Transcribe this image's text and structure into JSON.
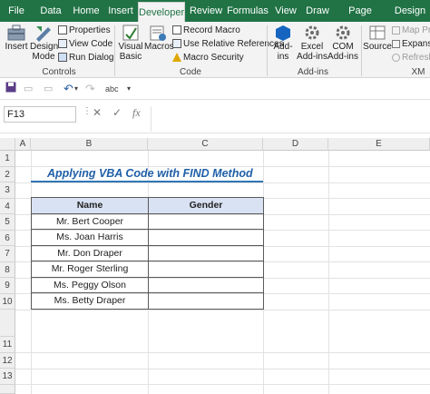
{
  "ribbon_tabs": [
    "File",
    "Data",
    "Home",
    "Insert",
    "Developer",
    "Review",
    "Formulas",
    "View",
    "Draw",
    "Page Layout",
    "Design"
  ],
  "active_tab": "Developer",
  "controls_group": {
    "insert": "Insert",
    "design_mode_1": "Design",
    "design_mode_2": "Mode",
    "properties": "Properties",
    "view_code": "View Code",
    "run_dialog": "Run Dialog",
    "label": "Controls"
  },
  "code_group": {
    "visual_basic_1": "Visual",
    "visual_basic_2": "Basic",
    "macros": "Macros",
    "record_macro": "Record Macro",
    "relative_refs": "Use Relative References",
    "macro_security": "Macro Security",
    "label": "Code"
  },
  "addins_group": {
    "addins_1": "Add-",
    "addins_2": "ins",
    "excel_addins_1": "Excel",
    "excel_addins_2": "Add-ins",
    "com_addins_1": "COM",
    "com_addins_2": "Add-ins",
    "label": "Add-ins"
  },
  "xml_group": {
    "source": "Source",
    "map_properties": "Map Prope",
    "expansion": "Expansio",
    "refresh": "Refresh D",
    "label": "XM"
  },
  "name_box": "F13",
  "fx_label": "fx",
  "columns": [
    "A",
    "B",
    "C",
    "D",
    "E"
  ],
  "rows": [
    "1",
    "2",
    "3",
    "4",
    "5",
    "6",
    "7",
    "8",
    "9",
    "10",
    "11",
    "12",
    "13"
  ],
  "sheet": {
    "title": "Applying VBA Code with FIND Method",
    "headers": [
      "Name",
      "Gender"
    ],
    "names": [
      "Mr. Bert Cooper",
      "Ms. Joan Harris",
      "Mr. Don Draper",
      "Mr. Roger Sterling",
      "Ms. Peggy Olson",
      "Ms. Betty Draper"
    ],
    "genders": [
      "",
      "",
      "",
      "",
      "",
      ""
    ]
  }
}
